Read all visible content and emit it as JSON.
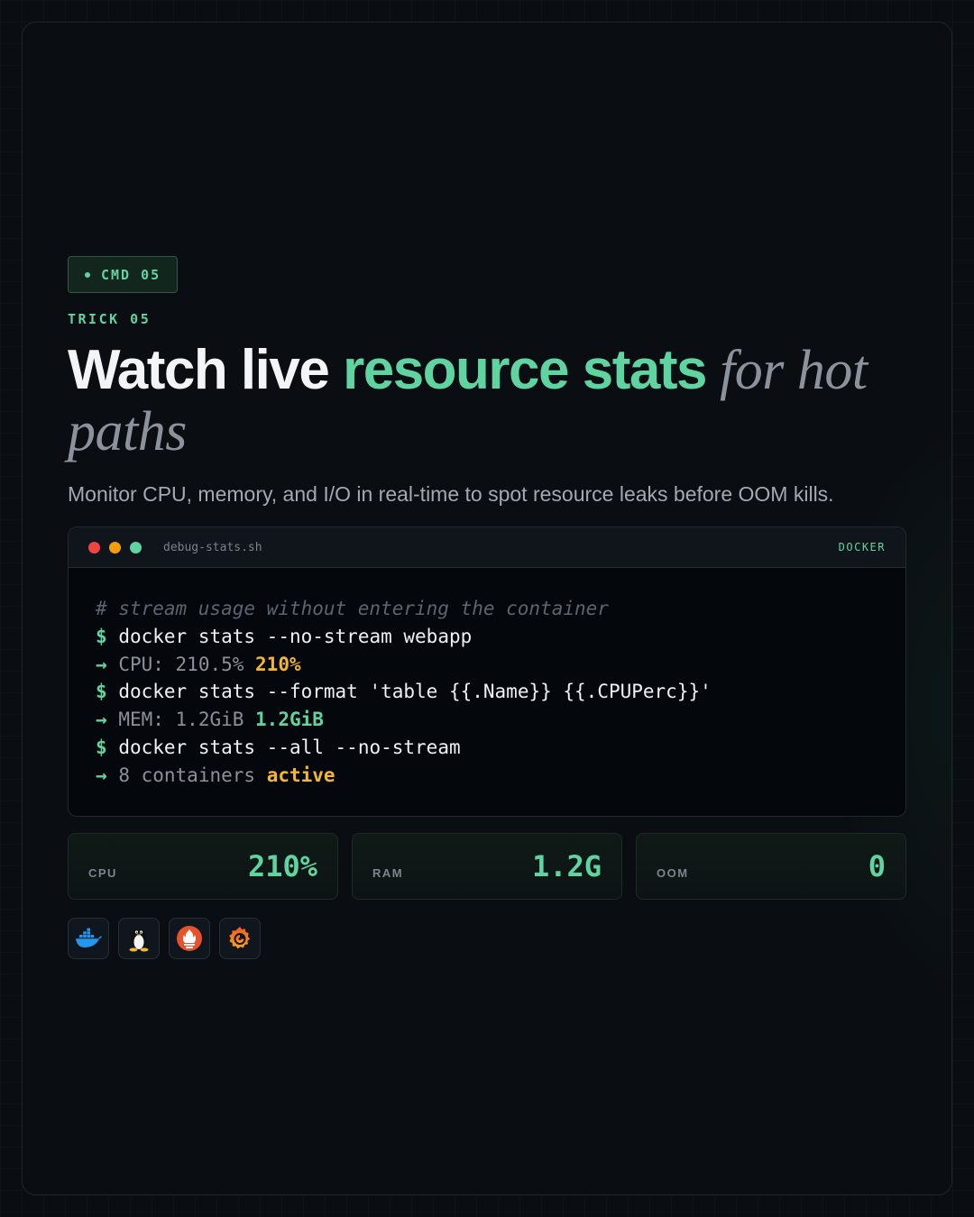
{
  "badge": {
    "label": "CMD 05"
  },
  "eyebrow": "TRICK 05",
  "headline": {
    "part1": "Watch live ",
    "accent": "resource stats",
    "serif": " for hot paths"
  },
  "subtitle": "Monitor CPU, memory, and I/O in real-time to spot resource leaks before OOM kills.",
  "terminal": {
    "filename": "debug-stats.sh",
    "tag": "DOCKER",
    "lights": [
      "#ef4444",
      "#f59e0b",
      "#5fd4a0"
    ],
    "lines": {
      "comment": "# stream usage without entering the container",
      "prompt": "$",
      "arrow": "→",
      "cmd1": "docker stats --no-stream webapp",
      "out1_text": "CPU: 210.5% ",
      "out1_hl": "210%",
      "cmd2": "docker stats --format 'table {{.Name}} {{.CPUPerc}}'",
      "out2_text": "MEM: 1.2GiB ",
      "out2_hl": "1.2GiB",
      "cmd3": "docker stats --all --no-stream",
      "out3_text": "8 containers ",
      "out3_hl": "active"
    }
  },
  "stats": [
    {
      "label": "CPU",
      "value": "210%"
    },
    {
      "label": "RAM",
      "value": "1.2G"
    },
    {
      "label": "OOM",
      "value": "0"
    }
  ],
  "tech_icons": [
    "docker-icon",
    "linux-tux-icon",
    "prometheus-icon",
    "grafana-icon"
  ],
  "colors": {
    "accent": "#5fd4a0",
    "amber": "#f5b731",
    "background": "#0a0d12"
  }
}
